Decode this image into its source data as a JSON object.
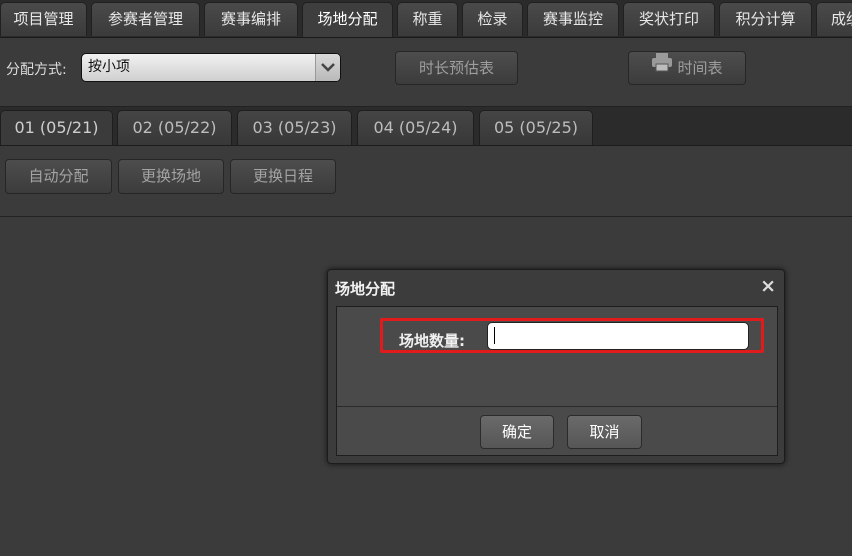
{
  "top_tabs": [
    {
      "label": "项目管理",
      "active": false
    },
    {
      "label": "参赛者管理",
      "active": false
    },
    {
      "label": "赛事编排",
      "active": false
    },
    {
      "label": "场地分配",
      "active": true
    },
    {
      "label": "称重",
      "active": false
    },
    {
      "label": "检录",
      "active": false
    },
    {
      "label": "赛事监控",
      "active": false
    },
    {
      "label": "奖状打印",
      "active": false
    },
    {
      "label": "积分计算",
      "active": false
    },
    {
      "label": "成绩",
      "active": false
    }
  ],
  "toolbar": {
    "allocation_label": "分配方式:",
    "allocation_value": "按小项",
    "duration_button": "时长预估表",
    "schedule_button": "时间表"
  },
  "date_tabs": [
    {
      "label": "01 (05/21)",
      "active": true
    },
    {
      "label": "02 (05/22)",
      "active": false
    },
    {
      "label": "03 (05/23)",
      "active": false
    },
    {
      "label": "04 (05/24)",
      "active": false
    },
    {
      "label": "05 (05/25)",
      "active": false
    }
  ],
  "actions": {
    "auto_allocate": "自动分配",
    "change_venue": "更换场地",
    "change_schedule": "更换日程"
  },
  "modal": {
    "title": "场地分配",
    "close": "×",
    "field_label": "场地数量:",
    "field_value": "",
    "confirm": "确定",
    "cancel": "取消"
  },
  "colors": {
    "background": "#3b3b3b",
    "highlight": "#e11b1b"
  }
}
